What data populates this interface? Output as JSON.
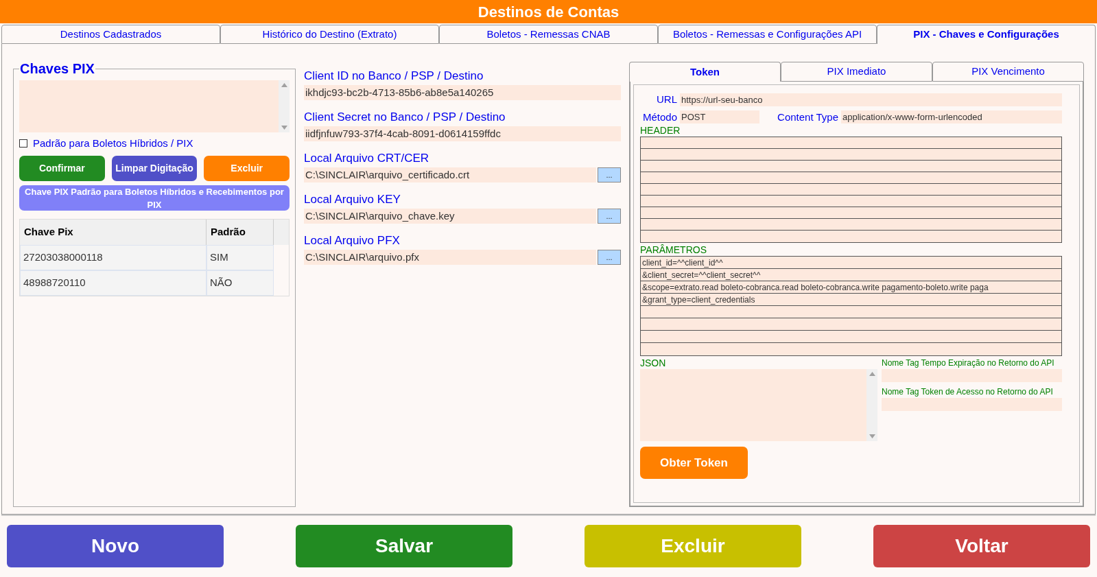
{
  "window": {
    "title": "Destinos de Contas"
  },
  "tabs": [
    {
      "label": "Destinos Cadastrados",
      "selected": false
    },
    {
      "label": "Histórico do Destino (Extrato)",
      "selected": false
    },
    {
      "label": "Boletos - Remessas CNAB",
      "selected": false
    },
    {
      "label": "Boletos - Remessas e Configurações API",
      "selected": false
    },
    {
      "label": "PIX - Chaves e Configurações",
      "selected": true
    }
  ],
  "chaves_pix": {
    "legend": "Chaves PIX",
    "default_checkbox": {
      "label": "Padrão para Boletos Híbridos / PIX",
      "checked": false
    },
    "buttons": [
      {
        "label": "Confirmar",
        "color": "#228b22"
      },
      {
        "label": "Limpar Digitação",
        "color": "#5050c8"
      },
      {
        "label": "Excluir",
        "color": "#ff8000"
      }
    ],
    "info_banner": "Chave PIX Padrão para Boletos Híbridos e Recebimentos por PIX",
    "table": {
      "columns": [
        "Chave Pix",
        "Padrão"
      ],
      "rows": [
        {
          "cells": [
            "27203038000118",
            "SIM"
          ]
        },
        {
          "cells": [
            "48988720110",
            "NÃO"
          ]
        }
      ]
    }
  },
  "credentials": [
    {
      "label": "Client ID no Banco / PSP / Destino",
      "value": "ikhdjc93-bc2b-4713-85b6-ab8e5a140265",
      "kind": "text"
    },
    {
      "label": "Client Secret no Banco / PSP / Destino",
      "value": "iidfjnfuw793-37f4-4cab-8091-d0614159ffdc",
      "kind": "text"
    },
    {
      "label": "Local Arquivo CRT/CER",
      "value": "C:\\SINCLAIR\\arquivo_certificado.crt",
      "kind": "file",
      "browse": "..."
    },
    {
      "label": "Local Arquivo KEY",
      "value": "C:\\SINCLAIR\\arquivo_chave.key",
      "kind": "file",
      "browse": "..."
    },
    {
      "label": "Local Arquivo PFX",
      "value": "C:\\SINCLAIR\\arquivo.pfx",
      "kind": "file",
      "browse": "..."
    }
  ],
  "sub_tabs": [
    {
      "label": "Token",
      "selected": true
    },
    {
      "label": "PIX Imediato",
      "selected": false
    },
    {
      "label": "PIX Vencimento",
      "selected": false
    }
  ],
  "token": {
    "url": {
      "label": "URL",
      "value": "https://url-seu-banco"
    },
    "method": {
      "label": "Método",
      "value": "POST"
    },
    "content_type": {
      "label": "Content Type",
      "value": "application/x-www-form-urlencoded"
    },
    "header_label": "HEADER",
    "params_label": "PARÂMETROS",
    "params": [
      "client_id=^^client_id^^",
      "&client_secret=^^client_secret^^",
      "&scope=extrato.read boleto-cobranca.read boleto-cobranca.write pagamento-boleto.write paga",
      "&grant_type=client_credentials"
    ],
    "json_label": "JSON",
    "expiry_tag_label": "Nome Tag Tempo Expiração no Retorno do API",
    "access_tag_label": "Nome Tag Token de Acesso no Retorno do API",
    "get_token_button": "Obter Token"
  },
  "footer_buttons": [
    {
      "label": "Novo",
      "color": "#5050c8"
    },
    {
      "label": "Salvar",
      "color": "#228b22"
    },
    {
      "label": "Excluir",
      "color": "#c8c000"
    },
    {
      "label": "Voltar",
      "color": "#cc4444"
    }
  ]
}
